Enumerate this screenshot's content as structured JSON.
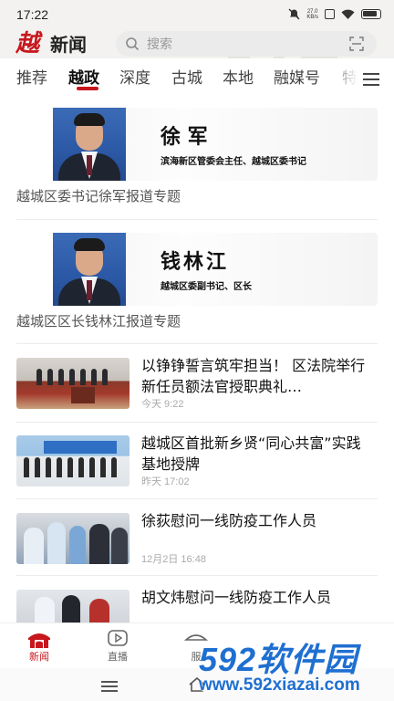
{
  "status_bar": {
    "time": "17:22",
    "speed": "27.0\nKB/s"
  },
  "header": {
    "logo": "越",
    "title": "新闻",
    "search_placeholder": "搜索"
  },
  "tabs": [
    {
      "label": "推荐",
      "active": false
    },
    {
      "label": "越政",
      "active": true
    },
    {
      "label": "深度",
      "active": false
    },
    {
      "label": "古城",
      "active": false
    },
    {
      "label": "本地",
      "active": false
    },
    {
      "label": "融媒号",
      "active": false
    },
    {
      "label": "特",
      "active": false
    }
  ],
  "features": [
    {
      "name": "徐    军",
      "title": "滨海新区管委会主任、越城区委书记",
      "caption": "越城区委书记徐军报道专题"
    },
    {
      "name": "钱林江",
      "title": "越城区委副书记、区长",
      "caption": "越城区区长钱林江报道专题"
    }
  ],
  "news": [
    {
      "title": "以铮铮誓言筑牢担当！ 区法院举行新任员额法官授职典礼…",
      "time": "今天  9:22"
    },
    {
      "title": "越城区首批新乡贤“同心共富”实践基地授牌",
      "time": "昨天  17:02"
    },
    {
      "title": "徐荻慰问一线防疫工作人员",
      "time": "12月2日  16:48"
    },
    {
      "title": "胡文炜慰问一线防疫工作人员",
      "time": ""
    }
  ],
  "bottom_nav": [
    {
      "label": "新闻",
      "icon": "home-gate-icon",
      "active": true
    },
    {
      "label": "直播",
      "icon": "live-play-icon",
      "active": false
    },
    {
      "label": "服",
      "icon": "service-icon",
      "active": false
    }
  ],
  "watermark": {
    "brand": "592软件园",
    "url": "www.592xiazai.com"
  },
  "colors": {
    "accent": "#c8161d",
    "watermark": "#1f6fd1"
  }
}
